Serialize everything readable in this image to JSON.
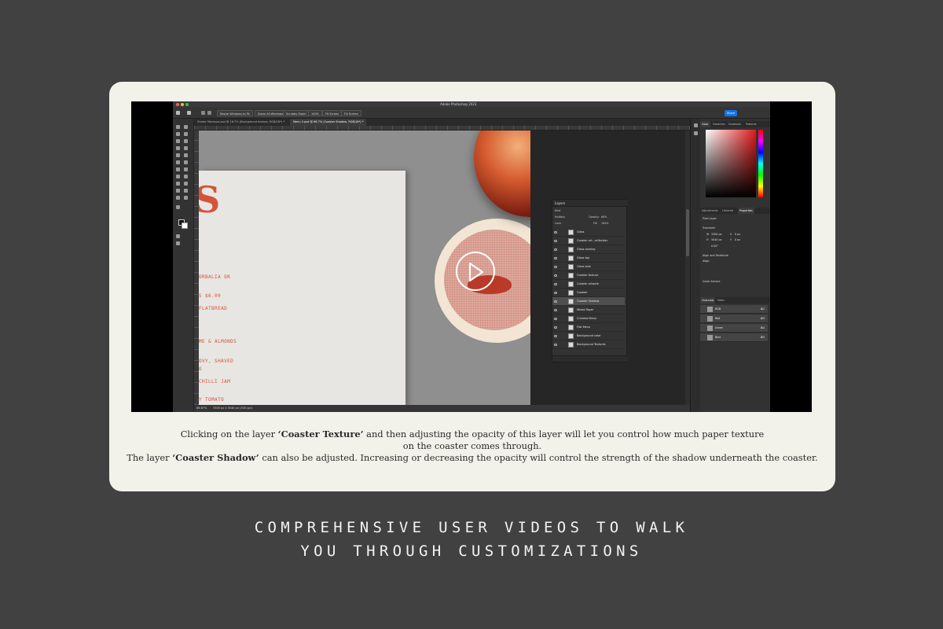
{
  "photoshop": {
    "app_title": "Adobe Photoshop 2023",
    "options_bar": {
      "resize_windows": "Resize Windows to Fit",
      "zoom_all": "Zoom All Windows",
      "scrubby_zoom": "Scrubby Zoom",
      "zoom_100": "100%",
      "fit_screen": "Fit Screen",
      "fill_screen": "Fill Screen",
      "share": "Share"
    },
    "doc_tabs": [
      {
        "label": "Sticker Mockups.psd @ 16.7% (Background texture, RGB/16*) *",
        "active": false
      },
      {
        "label": "Menu 2.psd @ 66.7% (Coaster Shadow, RGB/16*) *",
        "active": true
      }
    ],
    "canvas_menu": {
      "big_letter": "S",
      "lines": [
        "ORBALIA OR",
        "S $6.00",
        "FLATBREAD",
        "ME & ALMONDS",
        "OVY, SHAVED",
        "O",
        "CHILLI JAM",
        "Y TOMATO"
      ]
    },
    "status": {
      "zoom": "66.67%",
      "doc_size": "3300 px x 5040 px (300 ppi)"
    },
    "layers_panel": {
      "title": "Layers",
      "kind": "Kind",
      "blend_mode": "Multiply",
      "opacity_label": "Opacity:",
      "opacity_value": "68%",
      "lock_label": "Lock:",
      "fill_label": "Fill:",
      "fill_value": "100%",
      "rows": [
        {
          "name": "Glass",
          "selected": false
        },
        {
          "name": "Coaster art...reflection",
          "selected": false
        },
        {
          "name": "Glass overlay",
          "selected": false
        },
        {
          "name": "Glass top",
          "selected": false
        },
        {
          "name": "Glass side",
          "selected": false
        },
        {
          "name": "Coaster texture",
          "selected": false
        },
        {
          "name": "Coaster artwork",
          "selected": false
        },
        {
          "name": "Coaster",
          "selected": false
        },
        {
          "name": "Coaster Shadow",
          "selected": true
        },
        {
          "name": "Mixed Paper",
          "selected": false
        },
        {
          "name": "Crinkled Menu",
          "selected": false
        },
        {
          "name": "Flat Menu",
          "selected": false
        },
        {
          "name": "Background color",
          "selected": false
        },
        {
          "name": "Background Textures",
          "selected": false
        }
      ]
    },
    "right_panel": {
      "color_tabs": [
        "Color",
        "Swatches",
        "Gradients",
        "Patterns"
      ],
      "prop_tabs": [
        "Adjustments",
        "Libraries",
        "Properties"
      ],
      "pixel_layer": "Pixel Layer",
      "transform": "Transform",
      "w_label": "W",
      "w_value": "3300 px",
      "h_label": "H",
      "h_value": "5040 px",
      "x_label": "X",
      "x_value": "0 px",
      "y_label": "Y",
      "y_value": "0 px",
      "angle": "0.00°",
      "align": "Align and Distribute",
      "align_sub": "Align:",
      "quick_actions": "Quick Actions",
      "channel_tabs": [
        "Channels",
        "Paths"
      ],
      "channels": [
        {
          "name": "RGB",
          "shortcut": "⌘2"
        },
        {
          "name": "Red",
          "shortcut": "⌘3"
        },
        {
          "name": "Green",
          "shortcut": "⌘4"
        },
        {
          "name": "Blue",
          "shortcut": "⌘5"
        }
      ]
    }
  },
  "caption": {
    "l1_a": "Clicking on the layer ",
    "l1_b": "‘Coaster Texture’",
    "l1_c": " and then adjusting the opacity of this layer will let you control how much paper texture",
    "l2": "on the coaster comes through.",
    "l3_a": "The layer ",
    "l3_b": "‘Coaster Shadow’",
    "l3_c": " can also be adjusted. Increasing or decreasing the opacity will control the strength of the shadow underneath the coaster."
  },
  "headline": {
    "line1": "COMPREHENSIVE USER VIDEOS TO WALK",
    "line2": "YOU THROUGH CUSTOMIZATIONS"
  },
  "colors": {
    "background": "#414141",
    "card": "#f2f1ea",
    "accent": "#d5533a",
    "share": "#1473e6"
  }
}
